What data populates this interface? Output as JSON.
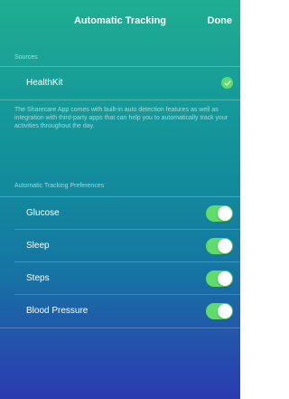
{
  "nav": {
    "title": "Automatic Tracking",
    "done_label": "Done"
  },
  "sources": {
    "header": "Sources",
    "items": [
      {
        "label": "HealthKit",
        "checked": true,
        "icon": "checkmark-icon"
      }
    ],
    "description": "The Sharecare App comes with built-in auto detection features as well as integration with third-party apps that can help you to automatically track your activities throughout the day."
  },
  "preferences": {
    "header": "Automatic Tracking Preferences",
    "items": [
      {
        "label": "Glucose",
        "enabled": true
      },
      {
        "label": "Sleep",
        "enabled": true
      },
      {
        "label": "Steps",
        "enabled": true
      },
      {
        "label": "Blood Pressure",
        "enabled": true
      }
    ]
  },
  "colors": {
    "toggle_on": "#5fdc6a",
    "gradient_top": "#1fae92",
    "gradient_bottom": "#2b3bb0"
  }
}
